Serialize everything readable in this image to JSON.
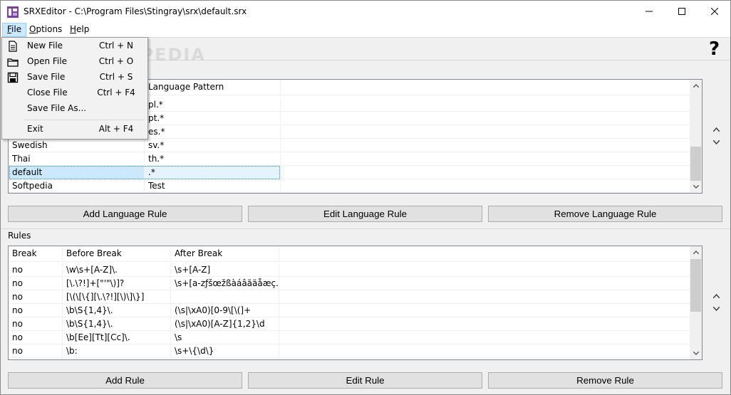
{
  "window": {
    "title": "SRXEditor - C:\\Program Files\\Stingray\\srx\\default.srx"
  },
  "menubar": {
    "file": "File",
    "options": "Options",
    "help": "Help"
  },
  "file_menu": {
    "items": [
      {
        "label": "New File",
        "shortcut": "Ctrl + N",
        "icon": "new-file-icon"
      },
      {
        "label": "Open File",
        "shortcut": "Ctrl + O",
        "icon": "open-folder-icon"
      },
      {
        "label": "Save File",
        "shortcut": "Ctrl + S",
        "icon": "save-disk-icon"
      },
      {
        "label": "Close File",
        "shortcut": "Ctrl + F4",
        "icon": ""
      },
      {
        "label": "Save File As...",
        "shortcut": "",
        "icon": ""
      },
      {
        "label": "Exit",
        "shortcut": "Alt + F4",
        "icon": ""
      }
    ]
  },
  "toolbar": {
    "help_glyph": "?",
    "watermark": "SOFTPEDIA"
  },
  "language_rules": {
    "columns": [
      "",
      "Language Pattern"
    ],
    "rows": [
      {
        "name": "",
        "pattern": "pl.*"
      },
      {
        "name": "",
        "pattern": "pt.*"
      },
      {
        "name": "",
        "pattern": "es.*"
      },
      {
        "name": "Swedish",
        "pattern": "sv.*"
      },
      {
        "name": "Thai",
        "pattern": "th.*"
      },
      {
        "name": "default",
        "pattern": ".*"
      },
      {
        "name": "Softpedia",
        "pattern": "Test"
      }
    ],
    "selected_row": 5,
    "buttons": {
      "add": "Add Language Rule",
      "edit": "Edit Language Rule",
      "remove": "Remove Language Rule"
    }
  },
  "rules": {
    "section_label": "Rules",
    "columns": [
      "Break",
      "Before Break",
      "After Break"
    ],
    "rows": [
      {
        "break": "no",
        "before": "\\w\\s+[A-Z]\\.",
        "after": "\\s+[A-Z]"
      },
      {
        "break": "no",
        "before": "[\\.\\?!]+[\"'\"\\)]?",
        "after": "\\s+[a-zƒšœžßàáâãäåæç..."
      },
      {
        "break": "no",
        "before": "[\\(\\[\\{][\\.\\?!][\\)\\]\\}]",
        "after": ""
      },
      {
        "break": "no",
        "before": "\\b\\S{1,4}\\.",
        "after": "(\\s|\\xA0)[0-9\\[\\(]+"
      },
      {
        "break": "no",
        "before": "\\b\\S{1,4}\\.",
        "after": "(\\s|\\xA0)[A-Z]{1,2}\\d"
      },
      {
        "break": "no",
        "before": "\\b[Ee][Tt][Cc]\\.",
        "after": "\\s"
      },
      {
        "break": "no",
        "before": "\\b:",
        "after": "\\s+\\{\\d\\}"
      }
    ],
    "buttons": {
      "add": "Add Rule",
      "edit": "Edit Rule",
      "remove": "Remove Rule"
    }
  },
  "colors": {
    "selection": "#cce8ff",
    "menu_active": "#cce8ff",
    "button_face": "#e1e1e1"
  }
}
